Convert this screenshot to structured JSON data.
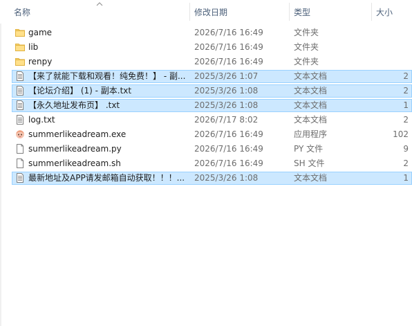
{
  "header": {
    "name": "名称",
    "date": "修改日期",
    "type": "类型",
    "size": "大小"
  },
  "rows": [
    {
      "name": "game",
      "date": "2026/7/16 16:49",
      "type": "文件夹",
      "size": "",
      "icon": "folder-icon",
      "selected": false
    },
    {
      "name": "lib",
      "date": "2026/7/16 16:49",
      "type": "文件夹",
      "size": "",
      "icon": "folder-icon",
      "selected": false
    },
    {
      "name": "renpy",
      "date": "2026/7/16 16:49",
      "type": "文件夹",
      "size": "",
      "icon": "folder-icon",
      "selected": false
    },
    {
      "name": "【来了就能下载和观看！纯免费！】 - 副...",
      "date": "2025/3/26 1:07",
      "type": "文本文档",
      "size": "2",
      "icon": "text-file-icon",
      "selected": true
    },
    {
      "name": "【论坛介绍】 (1) - 副本.txt",
      "date": "2025/3/26 1:08",
      "type": "文本文档",
      "size": "2",
      "icon": "text-file-icon",
      "selected": true
    },
    {
      "name": "【永久地址发布页】 .txt",
      "date": "2025/3/26 1:08",
      "type": "文本文档",
      "size": "1",
      "icon": "text-file-icon",
      "selected": true
    },
    {
      "name": "log.txt",
      "date": "2026/7/17 8:02",
      "type": "文本文档",
      "size": "2",
      "icon": "text-file-icon",
      "selected": false
    },
    {
      "name": "summerlikeadream.exe",
      "date": "2026/7/16 16:49",
      "type": "应用程序",
      "size": "102",
      "icon": "app-exe-icon",
      "selected": false
    },
    {
      "name": "summerlikeadream.py",
      "date": "2026/7/16 16:49",
      "type": "PY 文件",
      "size": "9",
      "icon": "blank-file-icon",
      "selected": false
    },
    {
      "name": "summerlikeadream.sh",
      "date": "2026/7/16 16:49",
      "type": "SH 文件",
      "size": "2",
      "icon": "blank-file-icon",
      "selected": false
    },
    {
      "name": "最新地址及APP请发邮箱自动获取！！！...",
      "date": "2025/3/26 1:08",
      "type": "文本文档",
      "size": "1",
      "icon": "text-file-icon",
      "selected": true
    }
  ]
}
